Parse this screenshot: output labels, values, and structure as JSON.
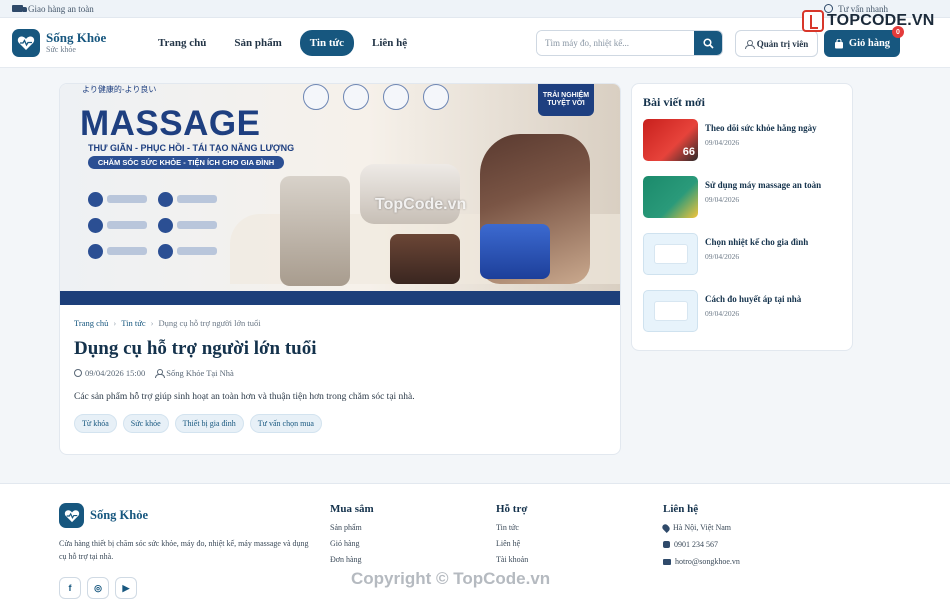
{
  "topbar": {
    "left_text": "Giao hàng an toàn",
    "right_text": "Tư vấn nhanh"
  },
  "header": {
    "brand_name": "Sống Khỏe",
    "brand_tagline": "Sức khỏe",
    "nav": [
      {
        "label": "Trang chủ",
        "active": false
      },
      {
        "label": "Sản phẩm",
        "active": false
      },
      {
        "label": "Tin tức",
        "active": true
      },
      {
        "label": "Liên hệ",
        "active": false
      }
    ],
    "search_placeholder": "Tìm máy đo, nhiệt kế...",
    "admin_label": "Quản trị viên",
    "cart_label": "Giỏ hàng",
    "cart_count": "0"
  },
  "watermark_logo": "TOPCODE.VN",
  "hero": {
    "top_small": "より健康的-より良い",
    "title": "MASSAGE",
    "subtitle": "THƯ GIÃN - PHỤC HỒI - TÁI TẠO NĂNG LƯỢNG",
    "pill": "CHĂM SÓC SỨC KHỎE - TIỆN ÍCH CHO GIA ĐÌNH",
    "badge": "TRẢI NGHIỆM TUYỆT VỜI",
    "watermark": "TopCode.vn"
  },
  "article": {
    "breadcrumbs": [
      "Trang chủ",
      "Tin tức",
      "Dụng cụ hỗ trợ người lớn tuổi"
    ],
    "title": "Dụng cụ hỗ trợ người lớn tuổi",
    "date": "09/04/2026 15:00",
    "author": "Sống Khỏe Tại Nhà",
    "description": "Các sản phẩm hỗ trợ giúp sinh hoạt an toàn hơn và thuận tiện hơn trong chăm sóc tại nhà.",
    "tags": [
      "Từ khóa",
      "Sức khỏe",
      "Thiết bị gia đình",
      "Tư vấn chọn mua"
    ]
  },
  "sidebar": {
    "title": "Bài viết mới",
    "posts": [
      {
        "title": "Theo dõi sức khỏe hằng ngày",
        "date": "09/04/2026"
      },
      {
        "title": "Sử dụng máy massage an toàn",
        "date": "09/04/2026"
      },
      {
        "title": "Chọn nhiệt kế cho gia đình",
        "date": "09/04/2026"
      },
      {
        "title": "Cách đo huyết áp tại nhà",
        "date": "09/04/2026"
      }
    ]
  },
  "footer": {
    "brand_name": "Sống Khỏe",
    "description": "Cửa hàng thiết bị chăm sóc sức khỏe, máy đo, nhiệt kế, máy massage và dụng cụ hỗ trợ tại nhà.",
    "socials": [
      "f",
      "◎",
      "▶"
    ],
    "shop_title": "Mua sắm",
    "shop_links": [
      "Sản phẩm",
      "Giỏ hàng",
      "Đơn hàng"
    ],
    "support_title": "Hỗ trợ",
    "support_links": [
      "Tin tức",
      "Liên hệ",
      "Tài khoản"
    ],
    "contact_title": "Liên hệ",
    "address": "Hà Nội, Việt Nam",
    "phone": "0901 234 567",
    "email": "hotro@songkhoe.vn",
    "copyright_watermark": "Copyright © TopCode.vn"
  }
}
